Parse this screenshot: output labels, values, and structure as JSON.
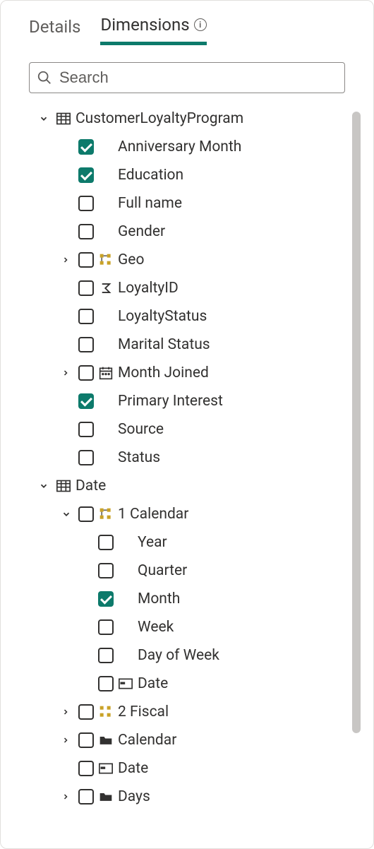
{
  "tabs": {
    "details": "Details",
    "dimensions": "Dimensions"
  },
  "search": {
    "placeholder": "Search"
  },
  "tree": {
    "customerLoyaltyProgram": "CustomerLoyaltyProgram",
    "anniversaryMonth": "Anniversary Month",
    "education": "Education",
    "fullName": "Full name",
    "gender": "Gender",
    "geo": "Geo",
    "loyaltyId": "LoyaltyID",
    "loyaltyStatus": "LoyaltyStatus",
    "maritalStatus": "Marital Status",
    "monthJoined": "Month Joined",
    "primaryInterest": "Primary Interest",
    "source": "Source",
    "status": "Status",
    "date": "Date",
    "calendar1": "1 Calendar",
    "year": "Year",
    "quarter": "Quarter",
    "month": "Month",
    "week": "Week",
    "dayOfWeek": "Day of Week",
    "dateLeaf": "Date",
    "fiscal2": "2 Fiscal",
    "calendarFolder": "Calendar",
    "dateLeaf2": "Date",
    "daysFolder": "Days"
  },
  "colors": {
    "accent": "#0d7a6b"
  }
}
